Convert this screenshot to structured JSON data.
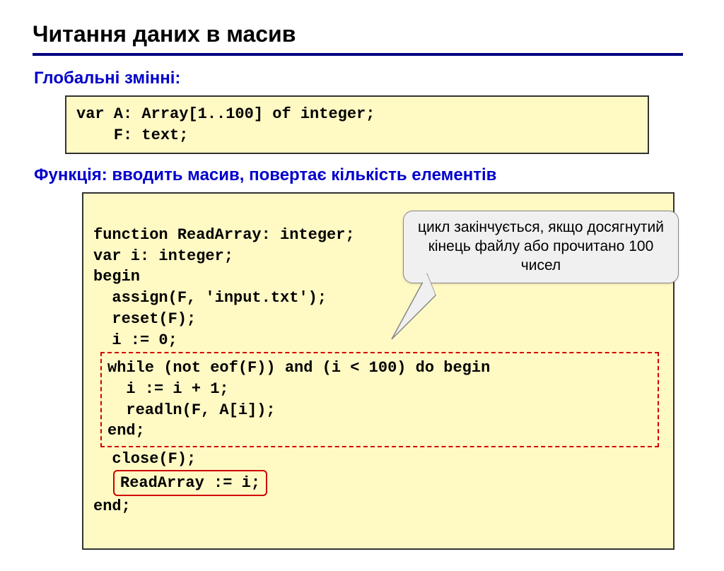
{
  "title": "Читання даних в масив",
  "sections": {
    "globals_label": "Глобальні змінні:",
    "function_label": "Функція: вводить масив, повертає кількість елементів"
  },
  "code": {
    "globals": "var A: Array[1..100] of integer;\n    F: text;",
    "fn_head": "function ReadArray: integer;\nvar i: integer;\nbegin\n  assign(F, 'input.txt');\n  reset(F);\n  i := 0;",
    "fn_loop": "while (not eof(F)) and (i < 100) do begin\n  i := i + 1;\n  readln(F, A[i]);\nend;",
    "fn_close": "  close(F);",
    "fn_return": "ReadArray := i;",
    "fn_end": "end;"
  },
  "callout": "цикл закінчується, якщо досягнутий кінець файлу або прочитано 100 чисел"
}
